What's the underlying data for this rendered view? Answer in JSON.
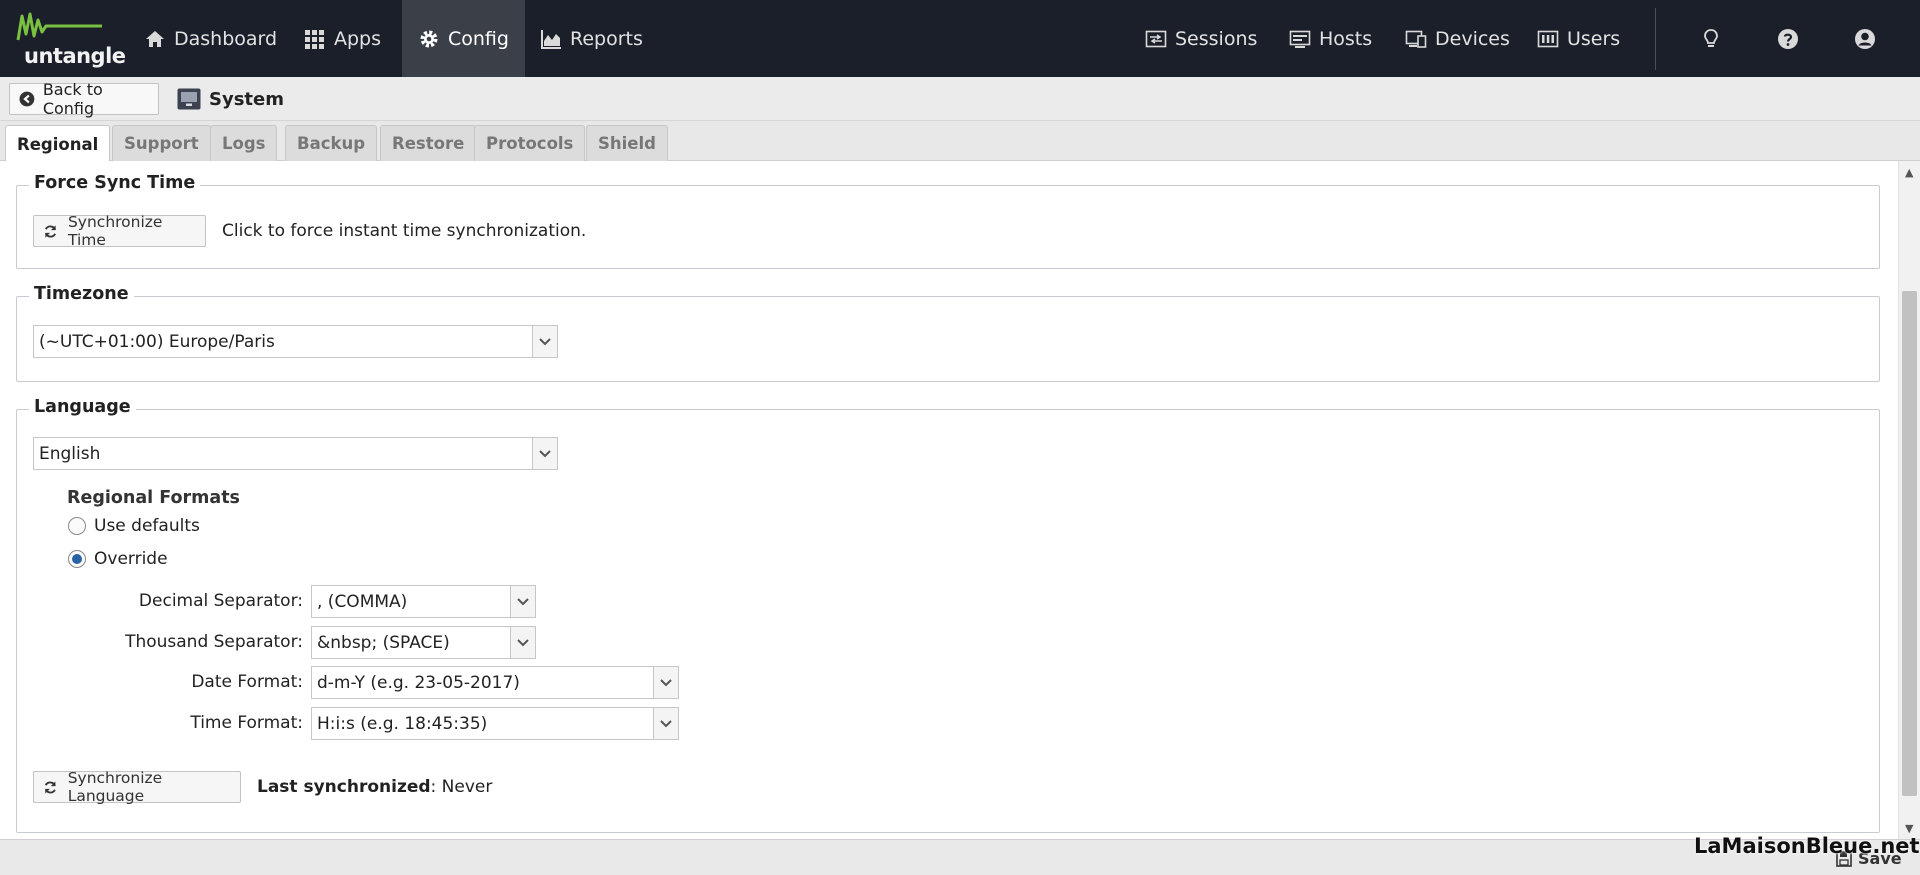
{
  "brand": {
    "logo_text": "untangle"
  },
  "nav": {
    "left": [
      {
        "label": "Dashboard",
        "icon": "home-icon"
      },
      {
        "label": "Apps",
        "icon": "apps-grid-icon"
      },
      {
        "label": "Config",
        "icon": "gear-icon",
        "active": true
      },
      {
        "label": "Reports",
        "icon": "area-chart-icon"
      }
    ],
    "right": [
      {
        "label": "Sessions",
        "icon": "sessions-icon"
      },
      {
        "label": "Hosts",
        "icon": "hosts-icon"
      },
      {
        "label": "Devices",
        "icon": "devices-icon"
      },
      {
        "label": "Users",
        "icon": "users-icon"
      }
    ],
    "utility_icons": [
      "lightbulb-icon",
      "help-icon",
      "account-icon"
    ]
  },
  "header": {
    "back_label": "Back to Config",
    "title": "System"
  },
  "tabs": [
    "Regional",
    "Support",
    "Logs",
    "Backup",
    "Restore",
    "Protocols",
    "Shield"
  ],
  "force_sync": {
    "legend": "Force Sync Time",
    "button": "Synchronize Time",
    "description": "Click to force instant time synchronization."
  },
  "timezone": {
    "legend": "Timezone",
    "value": "(~UTC+01:00) Europe/Paris"
  },
  "language": {
    "legend": "Language",
    "value": "English",
    "regional_formats_title": "Regional Formats",
    "radio_defaults": "Use defaults",
    "radio_override": "Override",
    "selected": "Override",
    "decimal_label": "Decimal Separator:",
    "decimal_value": ", (COMMA)",
    "thousand_label": "Thousand Separator:",
    "thousand_value": "&nbsp; (SPACE)",
    "date_label": "Date Format:",
    "date_value": "d-m-Y (e.g. 23-05-2017)",
    "time_label": "Time Format:",
    "time_value": "H:i:s (e.g. 18:45:35)",
    "sync_button": "Synchronize Language",
    "last_sync_label": "Last synchronized",
    "last_sync_value": ": Never"
  },
  "footer": {
    "save_label": "Save"
  },
  "watermark": "LaMaisonBleue.net",
  "colors": {
    "topbar": "#1b1f2a",
    "active_nav": "#3b3f48",
    "radio_checked": "#2a63a5"
  }
}
